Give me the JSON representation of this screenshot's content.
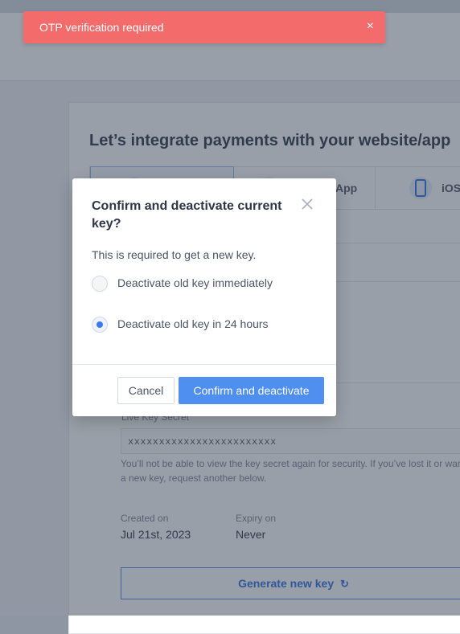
{
  "toast": {
    "message": "OTP verification required",
    "close_glyph": "×",
    "color": "#f46b6b"
  },
  "background": {
    "heading": "Let’s integrate payments with your website/app",
    "tabs": [
      {
        "label": "",
        "icon": "website-icon",
        "selected": true
      },
      {
        "label": "App",
        "icon": "android-icon",
        "selected": false
      },
      {
        "label": "iOS",
        "icon": "mobile-phone-icon",
        "selected": false
      }
    ],
    "live_key_secret_label": "Live Key Secret",
    "live_key_secret_value": "xxxxxxxxxxxxxxxxxxxxxxxx",
    "secret_note": "You’ll not be able to view the key secret again for security. If you’ve lost it or want a new key, request another below.",
    "created_on_label": "Created on",
    "created_on_value": "Jul 21st, 2023",
    "expiry_on_label": "Expiry on",
    "expiry_on_value": "Never",
    "generate_button": "Generate new key"
  },
  "modal": {
    "title": "Confirm and deactivate current key?",
    "description": "This is required to get a new key.",
    "options": [
      {
        "label": "Deactivate old key immediately",
        "checked": false
      },
      {
        "label": "Deactivate old key in 24 hours",
        "checked": true
      }
    ],
    "cancel_label": "Cancel",
    "confirm_label": "Confirm and deactivate",
    "accent_color": "#4f8ff0"
  }
}
